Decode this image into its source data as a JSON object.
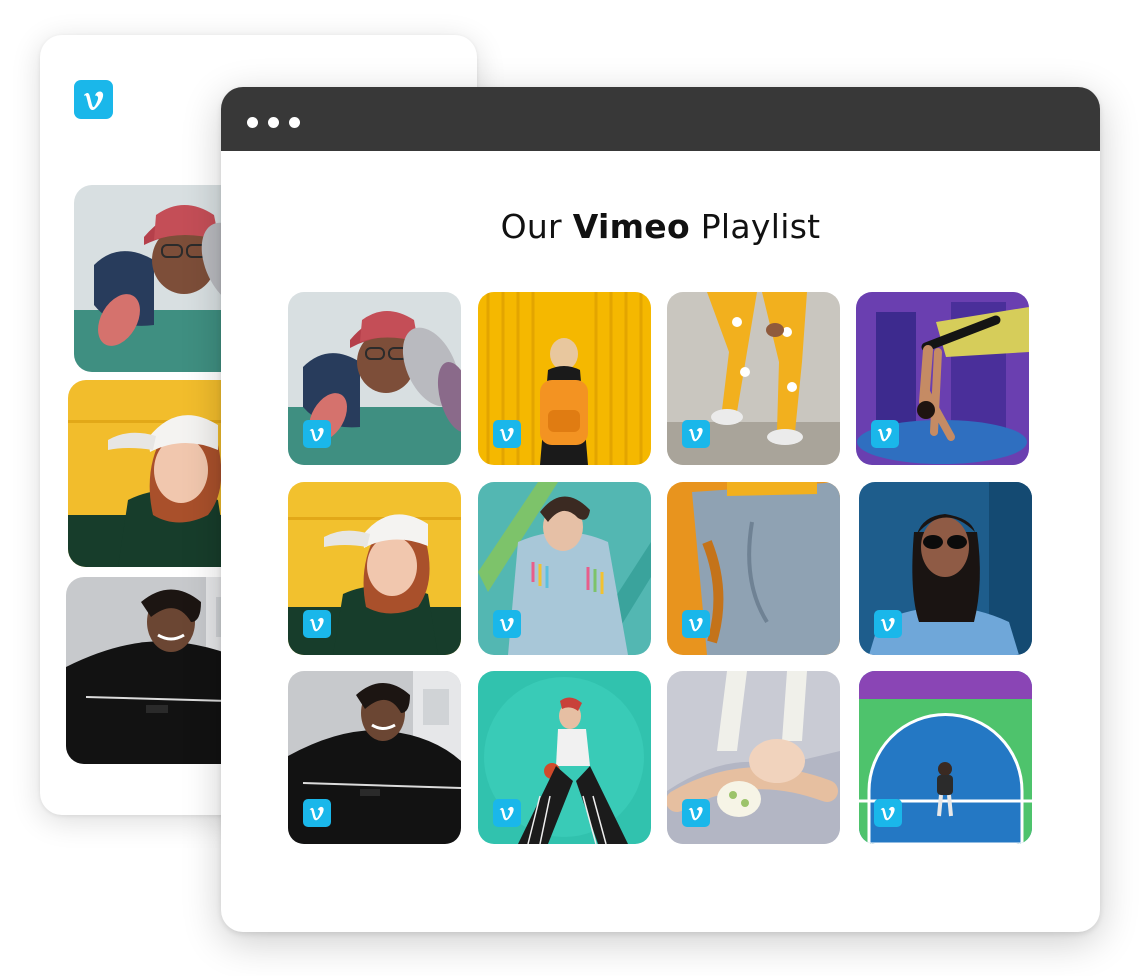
{
  "window": {
    "title_prefix": "Our",
    "title_brand": "Vimeo",
    "title_suffix": "Playlist"
  },
  "brand": {
    "name": "Vimeo",
    "accent_color": "#1ab7ea",
    "logo_icon": "vimeo-v-icon"
  },
  "back_card": {
    "tiles": [
      {
        "subject": "pink cap with shoes"
      },
      {
        "subject": "white cap on yellow"
      },
      {
        "subject": "black jacket smiling"
      }
    ]
  },
  "playlist": {
    "videos": [
      {
        "subject": "pink cap with shoes",
        "bg": "#8fb9b0"
      },
      {
        "subject": "yellow wall backpack",
        "bg": "#f5b800"
      },
      {
        "subject": "yellow patterned pants",
        "bg": "#c9c6bf"
      },
      {
        "subject": "handstand mural",
        "bg": "#6a3fb0"
      },
      {
        "subject": "white cap on yellow",
        "bg": "#f2c12e"
      },
      {
        "subject": "tassel denim jacket",
        "bg": "#53b7b2"
      },
      {
        "subject": "grey sweatpants",
        "bg": "#8fa2b3"
      },
      {
        "subject": "blue sunglasses",
        "bg": "#1e5d8c"
      },
      {
        "subject": "black jacket smiling",
        "bg": "#c7c7c7"
      },
      {
        "subject": "teal floor pose",
        "bg": "#31c2ae"
      },
      {
        "subject": "baby and legs",
        "bg": "#c9cbd4"
      },
      {
        "subject": "court lines",
        "bg": "#2478c4"
      }
    ]
  }
}
